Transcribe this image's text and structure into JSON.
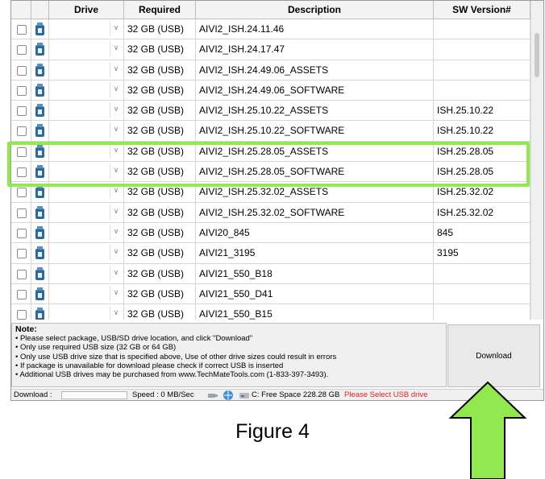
{
  "columns": {
    "drive": "Drive",
    "required": "Required",
    "description": "Description",
    "sw_version": "SW Version#"
  },
  "rows": [
    {
      "required": "32 GB (USB)",
      "description": "AIVI2_ISH.24.11.46",
      "version": ""
    },
    {
      "required": "32 GB (USB)",
      "description": "AIVI2_ISH.24.17.47",
      "version": ""
    },
    {
      "required": "32 GB (USB)",
      "description": "AIVI2_ISH.24.49.06_ASSETS",
      "version": ""
    },
    {
      "required": "32 GB (USB)",
      "description": "AIVI2_ISH.24.49.06_SOFTWARE",
      "version": ""
    },
    {
      "required": "32 GB (USB)",
      "description": "AIVI2_ISH.25.10.22_ASSETS",
      "version": "ISH.25.10.22"
    },
    {
      "required": "32 GB (USB)",
      "description": "AIVI2_ISH.25.10.22_SOFTWARE",
      "version": "ISH.25.10.22"
    },
    {
      "required": "32 GB (USB)",
      "description": "AIVI2_ISH.25.28.05_ASSETS",
      "version": "ISH.25.28.05"
    },
    {
      "required": "32 GB (USB)",
      "description": "AIVI2_ISH.25.28.05_SOFTWARE",
      "version": "ISH.25.28.05"
    },
    {
      "required": "32 GB (USB)",
      "description": "AIVI2_ISH.25.32.02_ASSETS",
      "version": "ISH.25.32.02"
    },
    {
      "required": "32 GB (USB)",
      "description": "AIVI2_ISH.25.32.02_SOFTWARE",
      "version": "ISH.25.32.02"
    },
    {
      "required": "32 GB (USB)",
      "description": "AIVI20_845",
      "version": "845"
    },
    {
      "required": "32 GB (USB)",
      "description": "AIVI21_3195",
      "version": "3195"
    },
    {
      "required": "32 GB (USB)",
      "description": "AIVI21_550_B18",
      "version": ""
    },
    {
      "required": "32 GB (USB)",
      "description": "AIVI21_550_D41",
      "version": ""
    },
    {
      "required": "32 GB (USB)",
      "description": "AIVI21_550_B15",
      "version": ""
    }
  ],
  "note": {
    "title": "Note:",
    "lines": [
      "• Please select package, USB/SD drive location, and click \"Download\"",
      "• Only use required USB size (32 GB or 64 GB)",
      "• Only use USB drive size that is specified above, Use of other drive sizes could result in errors",
      "• If package is unavailable for download please check if correct USB is inserted",
      "• Additional USB drives may be purchased from www.TechMateTools.com (1-833-397-3493)."
    ]
  },
  "download_button": "Download",
  "status": {
    "download_label": "Download :",
    "speed_label": "Speed : 0 MB/Sec",
    "free_space": "C: Free Space 228.28 GB",
    "warning": "Please Select USB drive",
    "warning_color": "#e02020"
  },
  "caption": "Figure 4",
  "colors": {
    "highlight": "#92e84f",
    "arrow": "#92e84f",
    "usb_icon": "#2d6a9c"
  }
}
